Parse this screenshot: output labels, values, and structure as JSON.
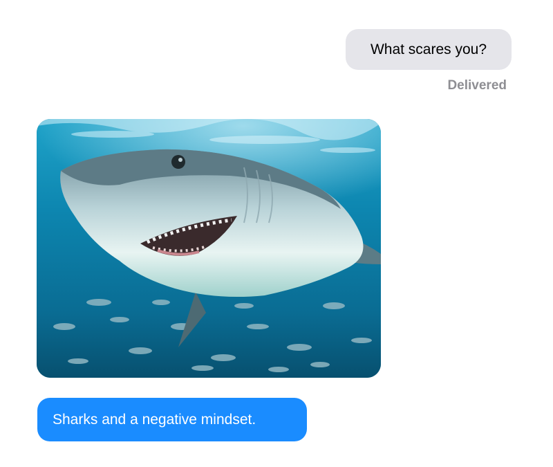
{
  "conversation": {
    "sent_message": "What scares you?",
    "delivery_status": "Delivered",
    "photo": {
      "icon": "shark-photo",
      "subject": "great white shark"
    },
    "received_message": "Sharks and a negative mindset."
  },
  "colors": {
    "sent_bubble": "#e5e5ea",
    "received_bubble": "#1a8cff",
    "status_text": "#8e8e93"
  }
}
